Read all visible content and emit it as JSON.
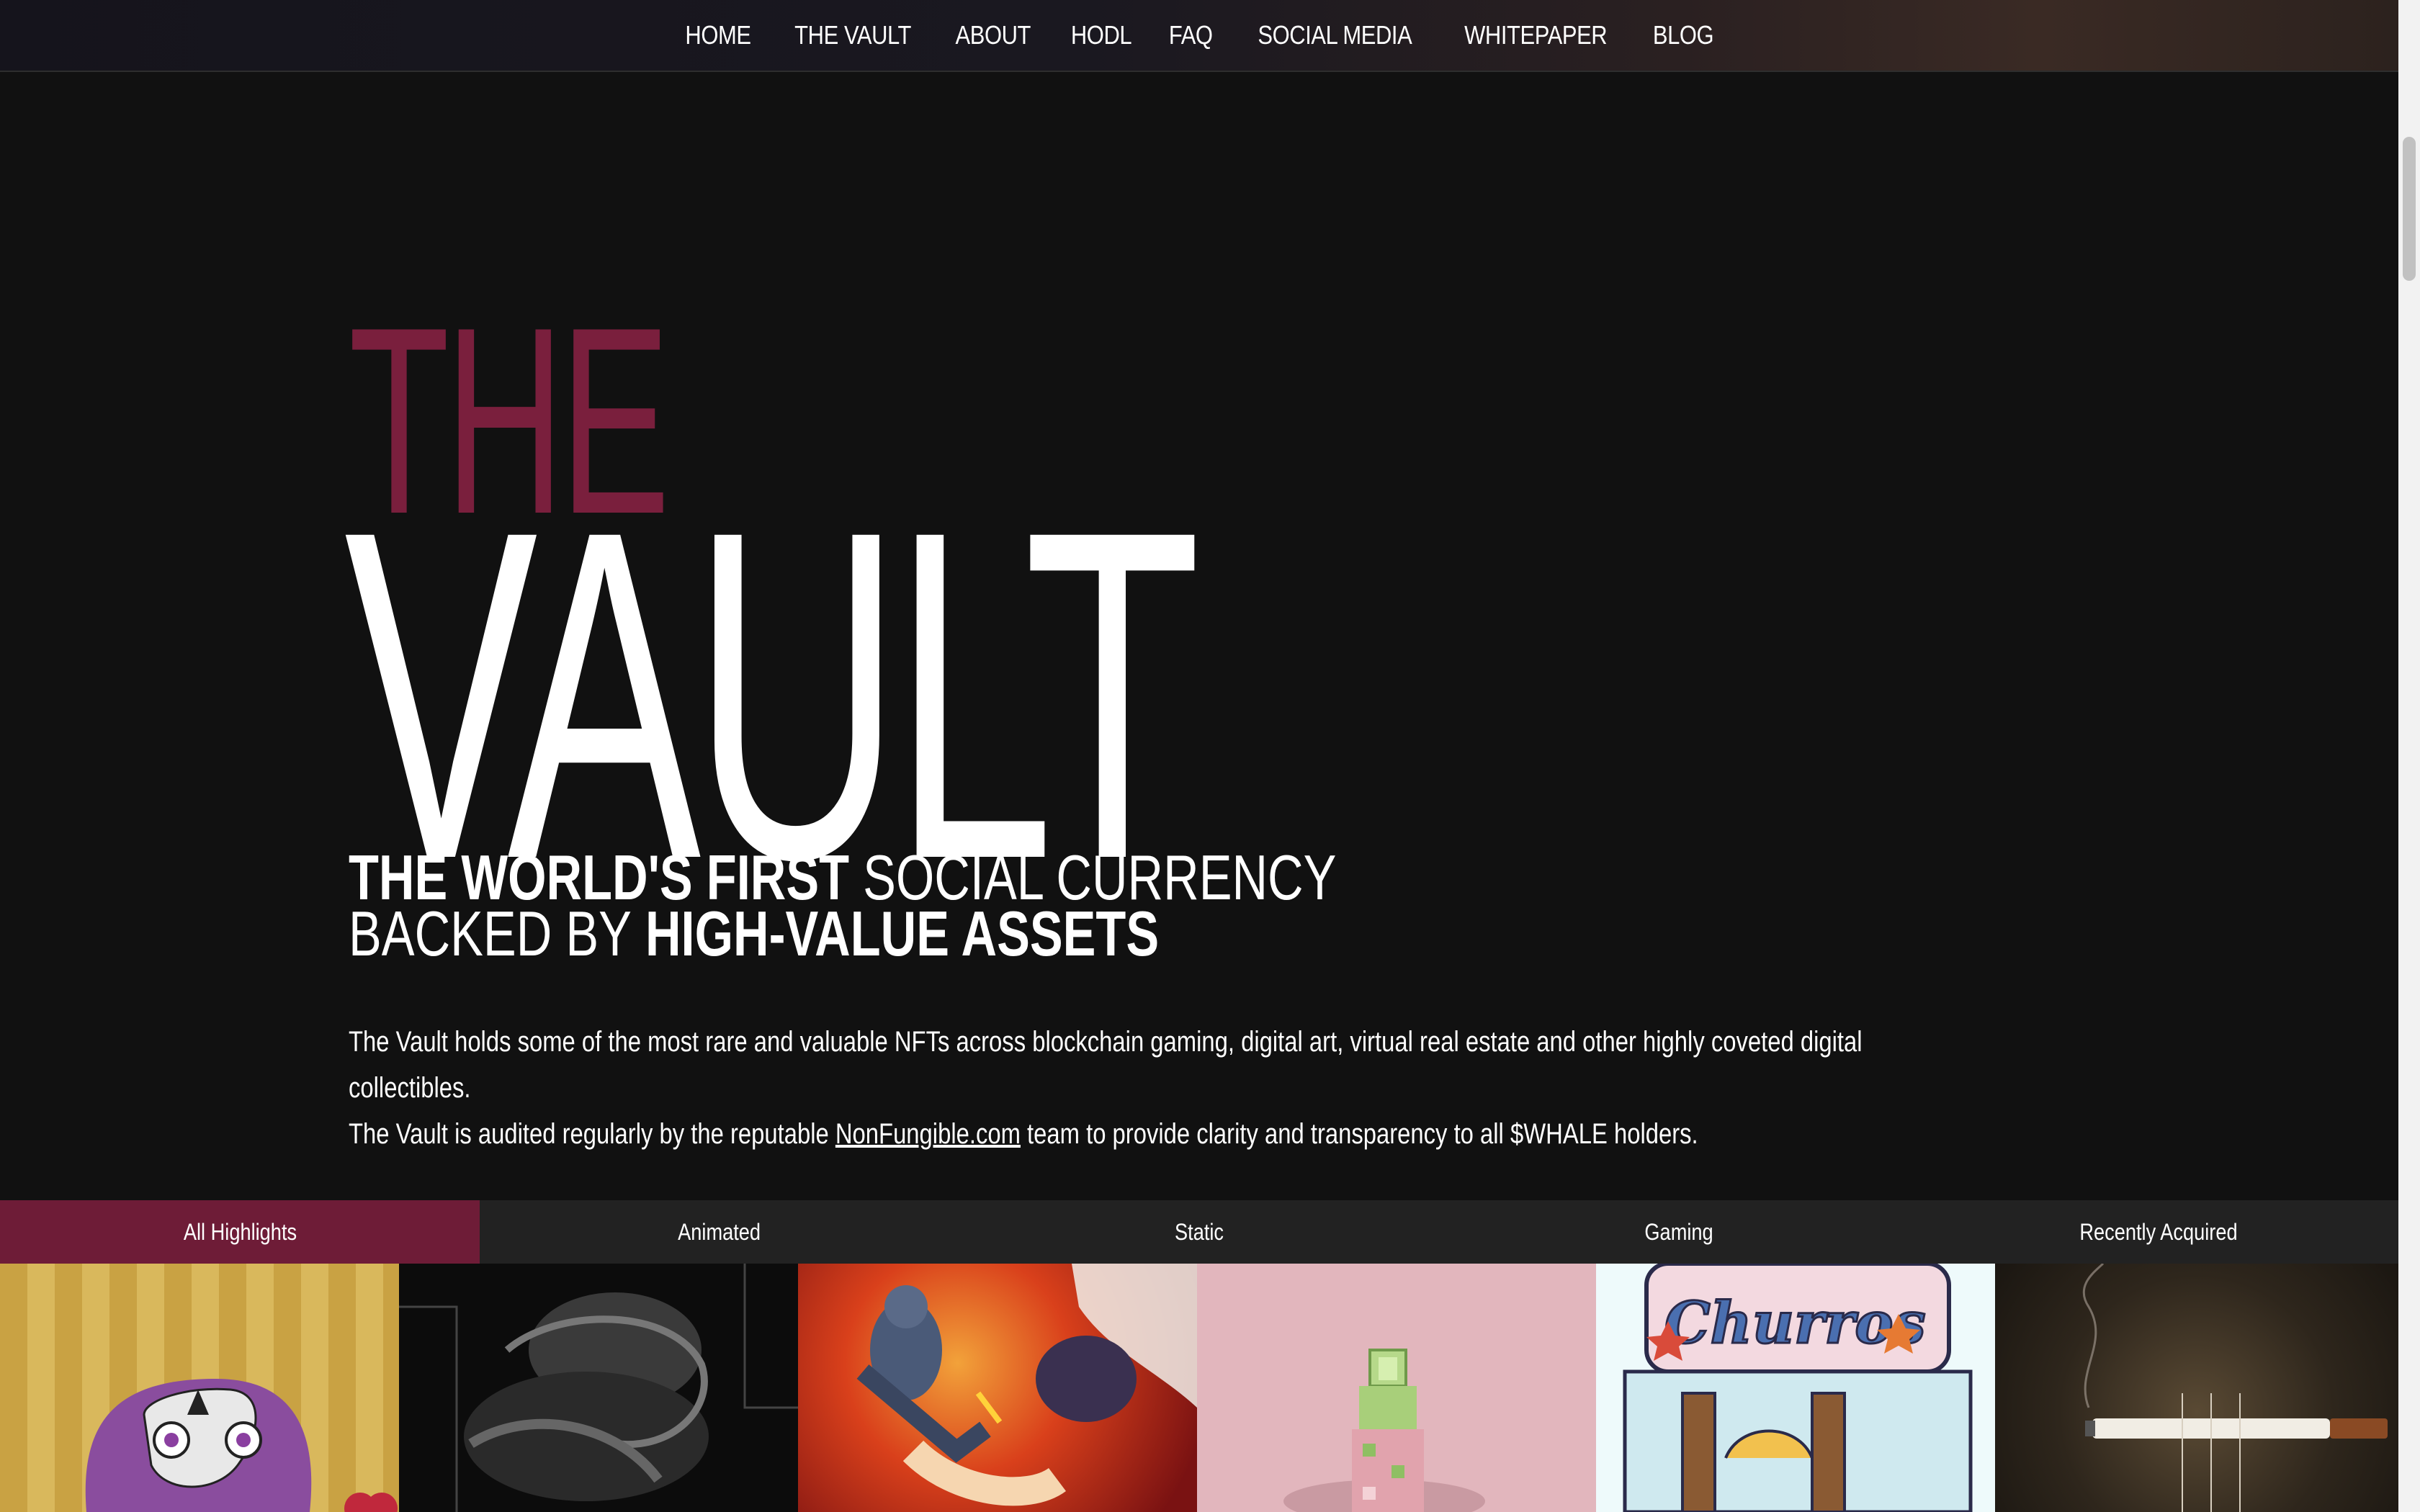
{
  "nav": {
    "items": [
      "HOME",
      "THE VAULT",
      "ABOUT",
      "HODL",
      "FAQ",
      "SOCIAL MEDIA",
      "WHITEPAPER",
      "BLOG"
    ]
  },
  "hero": {
    "the": "THE",
    "vault": "VAULT",
    "tagline": {
      "line1_bold": "THE WORLD'S FIRST",
      "line1_light": "SOCIAL CURRENCY",
      "line2_light": "BACKED BY",
      "line2_bold": "HIGH-VALUE ASSETS"
    },
    "description": {
      "line1": "The Vault holds some of the most rare and valuable NFTs across blockchain gaming, digital art, virtual real estate and other highly coveted digital collectibles.",
      "line2_before": "The Vault is audited regularly by the reputable",
      "link": "NonFungible.com",
      "line2_after": "team to provide clarity and transparency to all $WHALE holders."
    }
  },
  "tabs": [
    {
      "label": "All Highlights",
      "active": true
    },
    {
      "label": "Animated",
      "active": false
    },
    {
      "label": "Static",
      "active": false
    },
    {
      "label": "Gaming",
      "active": false
    },
    {
      "label": "Recently Acquired",
      "active": false
    }
  ],
  "colors": {
    "accent": "#7a1f3d",
    "active_tab": "#6e1c37",
    "background": "#111111"
  }
}
